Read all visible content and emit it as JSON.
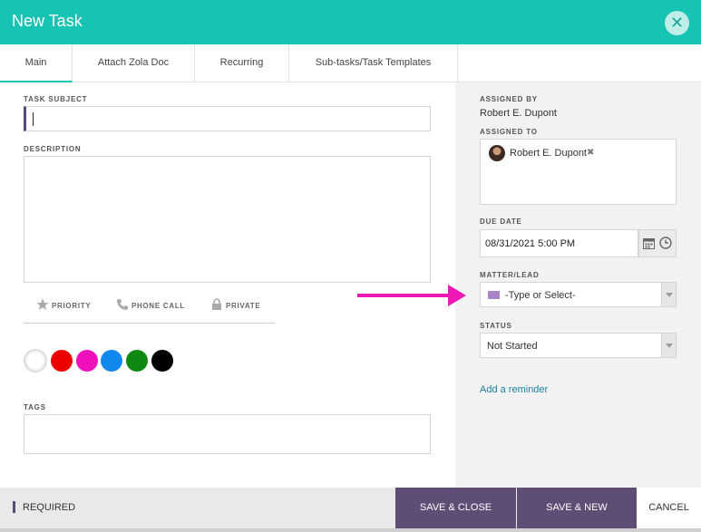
{
  "header": {
    "title": "New Task"
  },
  "tabs": [
    {
      "label": "Main",
      "active": true
    },
    {
      "label": "Attach Zola Doc",
      "active": false
    },
    {
      "label": "Recurring",
      "active": false
    },
    {
      "label": "Sub-tasks/Task Templates",
      "active": false
    }
  ],
  "form": {
    "subject_label": "TASK SUBJECT",
    "subject_value": "",
    "description_label": "DESCRIPTION",
    "description_value": "",
    "options": [
      {
        "label": "PRIORITY",
        "icon": "star-icon"
      },
      {
        "label": "PHONE CALL",
        "icon": "phone-icon"
      },
      {
        "label": "PRIVATE",
        "icon": "lock-icon"
      }
    ],
    "colors": [
      "#ffffff",
      "#ee0000",
      "#ee11bb",
      "#1188ee",
      "#118811",
      "#000000"
    ],
    "tags_label": "TAGS"
  },
  "sidebar": {
    "assigned_by_label": "ASSIGNED BY",
    "assigned_by_value": "Robert E. Dupont",
    "assigned_to_label": "ASSIGNED TO",
    "assigned_to_chip": "Robert E. Dupont",
    "chip_remove": "✖",
    "due_date_label": "DUE DATE",
    "due_date_value": "08/31/2021 5:00 PM",
    "matter_label": "MATTER/LEAD",
    "matter_placeholder": "-Type or Select-",
    "status_label": "STATUS",
    "status_value": "Not Started",
    "reminder_link": "Add a reminder"
  },
  "footer": {
    "required_label": "REQUIRED",
    "save_close_label": "SAVE & CLOSE",
    "save_new_label": "SAVE & NEW",
    "cancel_label": "CANCEL"
  },
  "colors": {
    "header": "#17c3b2",
    "accent_purple": "#5e4d74",
    "annotation_arrow": "#ee19b5"
  }
}
